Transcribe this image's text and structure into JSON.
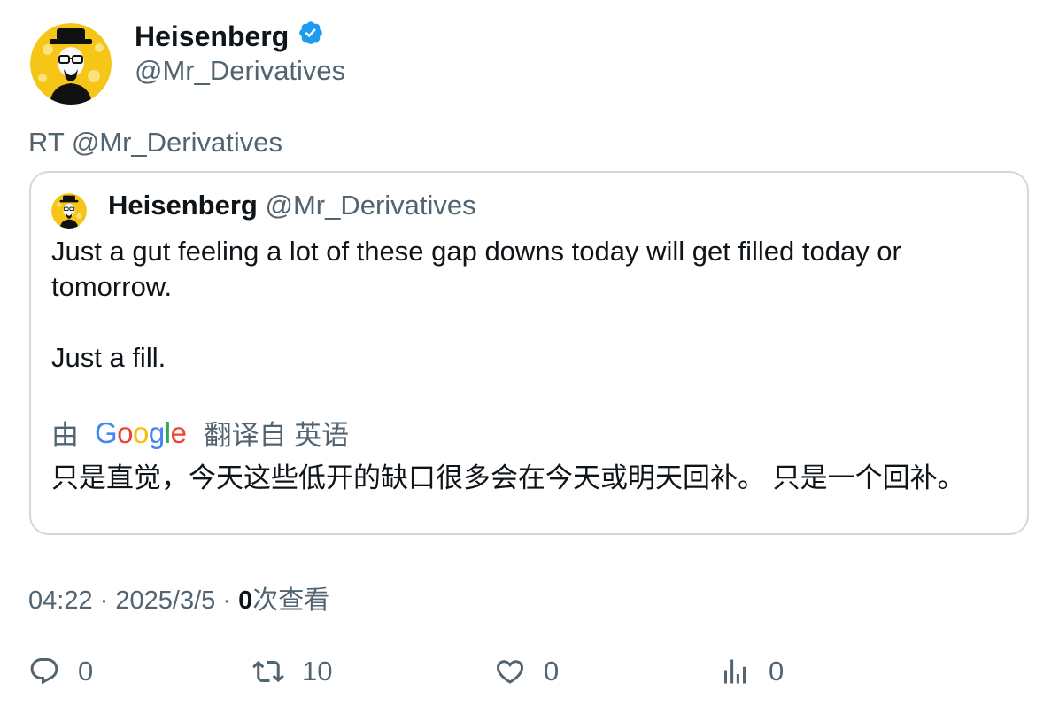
{
  "author": {
    "name": "Heisenberg",
    "handle": "@Mr_Derivatives",
    "verified_color": "#1d9bf0"
  },
  "retweet_line": "RT @Mr_Derivatives",
  "quoted": {
    "name": "Heisenberg",
    "handle": "@Mr_Derivatives",
    "text_line1": "Just a gut feeling a lot of these gap downs today will get filled today or tomorrow.",
    "text_line2": "Just a fill.",
    "translate_prefix": "由",
    "translate_brand": "Google",
    "translate_suffix": "翻译自 英语",
    "translated_text": "只是直觉，今天这些低开的缺口很多会在今天或明天回补。 只是一个回补。"
  },
  "meta": {
    "time": "04:22",
    "separator": "·",
    "date": "2025/3/5",
    "views_count": "0",
    "views_label": "次查看"
  },
  "actions": {
    "reply_count": "0",
    "retweet_count": "10",
    "like_count": "0",
    "views_count": "0"
  },
  "colors": {
    "text_primary": "#0f1419",
    "text_secondary": "#536471",
    "border": "#cfd9de",
    "avatar_bg": "#f5c518"
  }
}
